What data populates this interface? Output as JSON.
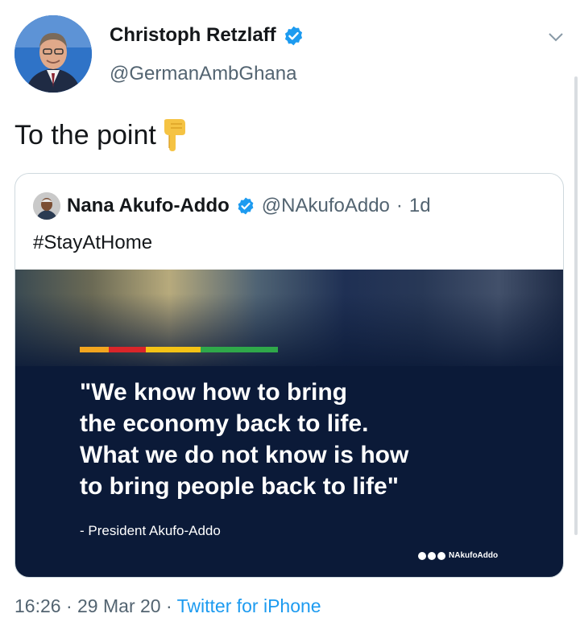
{
  "tweet": {
    "author_name": "Christoph Retzlaff",
    "author_handle": "@GermanAmbGhana",
    "text": "To the point",
    "emoji_icon": "backhand-index-pointing-down",
    "time": "16:26",
    "date": "29 Mar 20",
    "source": "Twitter for iPhone",
    "separator": "·"
  },
  "quoted": {
    "author_name": "Nana Akufo-Addo",
    "author_handle": "@NAkufoAddo",
    "age": "1d",
    "text": "#StayAtHome",
    "media": {
      "quote_lines": [
        "\"We know how to bring",
        "the economy back to life.",
        "What we do not know is how",
        "to bring people back to life\""
      ],
      "attribution": "- President Akufo-Addo",
      "social_handle": "NAkufoAddo",
      "stripe_colors": [
        "#f2a51f",
        "#d9252a",
        "#f4c316",
        "#2fa84a"
      ]
    }
  },
  "colors": {
    "verified": "#1d9bf0",
    "link": "#1d9bf0",
    "media_bg": "#0b1a38"
  }
}
